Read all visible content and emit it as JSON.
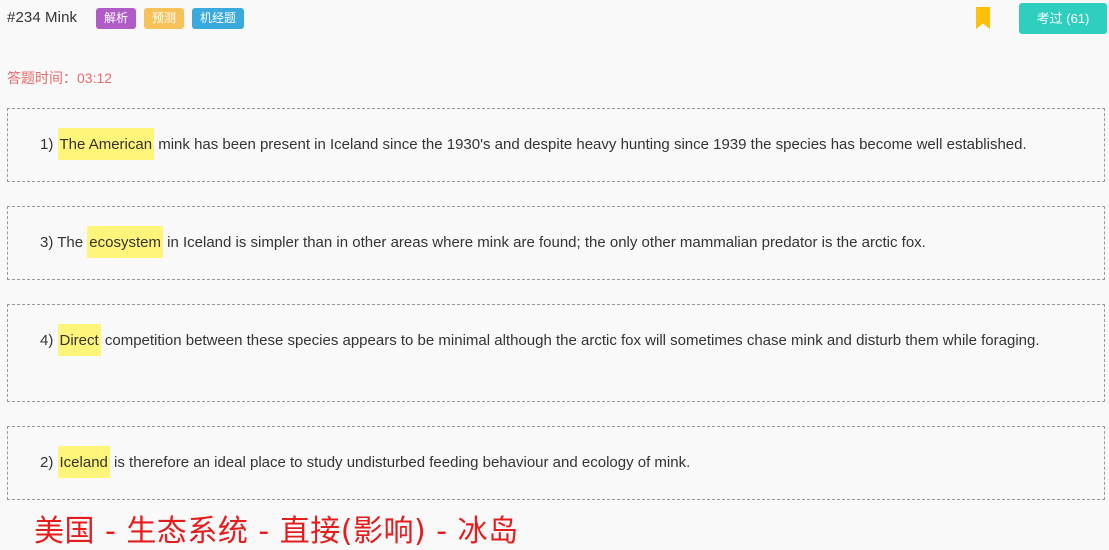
{
  "header": {
    "title": "#234 Mink",
    "tags": [
      "解析",
      "预测",
      "机经题"
    ],
    "exam_button_label": "考过 (61)",
    "colors": {
      "tag_purple": "#b05cc7",
      "tag_yellow": "#f8c25a",
      "tag_blue": "#3aa9dd",
      "exam_button": "#2ecfbf",
      "bookmark": "#ffc107"
    },
    "bookmark_icon": "bookmark-icon"
  },
  "timer": {
    "label": "答题时间：",
    "value": "03:12"
  },
  "sentences": [
    {
      "number": "1)",
      "pre": "",
      "highlight": "The American",
      "post": " mink has been present in Iceland since the 1930's and despite heavy hunting since 1939 the species has become well established."
    },
    {
      "number": "3)",
      "pre": "The ",
      "highlight": "ecosystem",
      "post": " in Iceland is simpler than in other areas where mink are found; the only other mammalian predator is the arctic fox."
    },
    {
      "number": "4)",
      "pre": "",
      "highlight": "Direct",
      "post": " competition between these species appears to be minimal although the arctic fox will sometimes chase mink and disturb them while foraging."
    },
    {
      "number": "2)",
      "pre": "",
      "highlight": "Iceland",
      "post": " is therefore an ideal place to study undisturbed feeding behaviour and ecology of mink."
    }
  ],
  "annotation": "美国 - 生态系统 - 直接(影响) - 冰岛",
  "colors": {
    "highlight": "#fff57a",
    "timer": "#e86a6a",
    "annotation": "#e41c1c"
  }
}
